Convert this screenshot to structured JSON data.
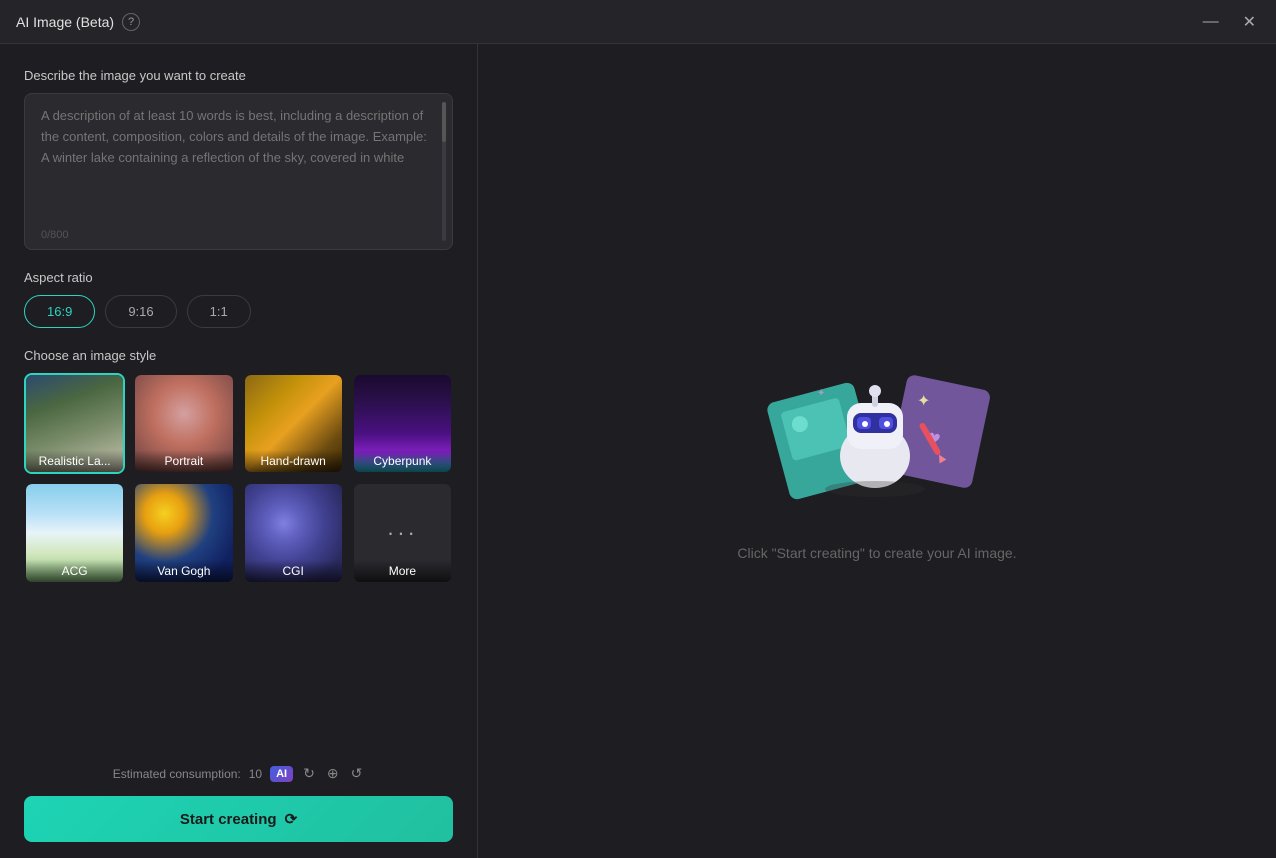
{
  "titlebar": {
    "title": "AI Image (Beta)",
    "help_label": "?",
    "minimize_label": "—",
    "close_label": "✕"
  },
  "left": {
    "describe_label": "Describe the image you want to create",
    "textarea_placeholder": "A description of at least 10 words is best, including a description of the content, composition, colors and details of the image. Example: A winter lake containing a reflection of the sky, covered in white",
    "char_count": "0/800",
    "aspect_ratio_label": "Aspect ratio",
    "aspect_options": [
      {
        "value": "16:9",
        "active": true
      },
      {
        "value": "9:16",
        "active": false
      },
      {
        "value": "1:1",
        "active": false
      }
    ],
    "style_label": "Choose an image style",
    "styles": [
      {
        "id": "realistic",
        "label": "Realistic La...",
        "active": true
      },
      {
        "id": "portrait",
        "label": "Portrait",
        "active": false
      },
      {
        "id": "handdrawn",
        "label": "Hand-drawn",
        "active": false
      },
      {
        "id": "cyberpunk",
        "label": "Cyberpunk",
        "active": false
      },
      {
        "id": "acg",
        "label": "ACG",
        "active": false
      },
      {
        "id": "vangogh",
        "label": "Van Gogh",
        "active": false
      },
      {
        "id": "cgi",
        "label": "CGI",
        "active": false
      },
      {
        "id": "more",
        "label": "More",
        "active": false
      }
    ],
    "consumption_label": "Estimated consumption:",
    "consumption_value": "10",
    "start_btn_label": "Start creating"
  },
  "right": {
    "hint_text": "Click \"Start creating\" to create your AI image."
  }
}
